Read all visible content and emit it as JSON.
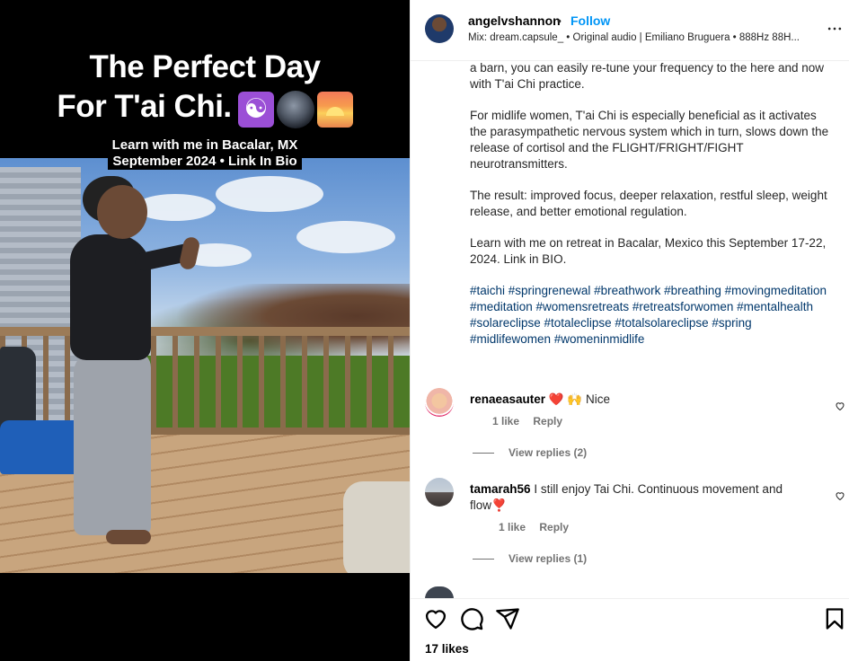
{
  "media": {
    "title_line1": "The Perfect Day",
    "title_line2": "For T'ai Chi.",
    "subtitle_line1": "Learn with me in Bacalar, MX",
    "subtitle_line2": "September 2024 • Link In Bio",
    "emoji_icons": [
      "yin-yang-icon",
      "full-moon-icon",
      "sunrise-icon"
    ]
  },
  "post_header": {
    "username": "angelvshannon",
    "separator": "•",
    "follow_label": "Follow",
    "audio": "Mix: dream.capsule_ • Original audio | Emiliano Bruguera • 888Hz 88H..."
  },
  "caption": {
    "paragraphs": [
      "a barn, you can easily re-tune your frequency to the here and now with T'ai Chi practice.",
      "For midlife women, T'ai Chi is especially beneficial as it activates the parasympathetic nervous system which in turn, slows down the release of cortisol and the FLIGHT/FRIGHT/FIGHT neurotransmitters.",
      "The result: improved focus, deeper relaxation, restful sleep, weight release, and better emotional regulation.",
      "Learn with me on retreat in Bacalar, Mexico this September 17-22, 2024. Link in BIO."
    ],
    "hashtags": "#taichi #springrenewal #breathwork #breathing #movingmeditation #meditation #womensretreats #retreatsforwomen #mentalhealth #solareclipse #totaleclipse #totalsolareclipse #spring #midlifewomen #womeninmidlife"
  },
  "comments": [
    {
      "username": "renaeasauter",
      "text": "❤️ 🙌 Nice",
      "likes": "1 like",
      "reply_label": "Reply",
      "view_replies": "View replies (2)"
    },
    {
      "username": "tamarah56",
      "text": "I still enjoy Tai Chi. Continuous movement and flow❣️",
      "likes": "1 like",
      "reply_label": "Reply",
      "view_replies": "View replies (1)"
    }
  ],
  "comment_peek_text": "…",
  "actions": {
    "icons": [
      "heart-icon",
      "comment-icon",
      "share-icon",
      "bookmark-icon"
    ],
    "likes_count": "17 likes"
  }
}
